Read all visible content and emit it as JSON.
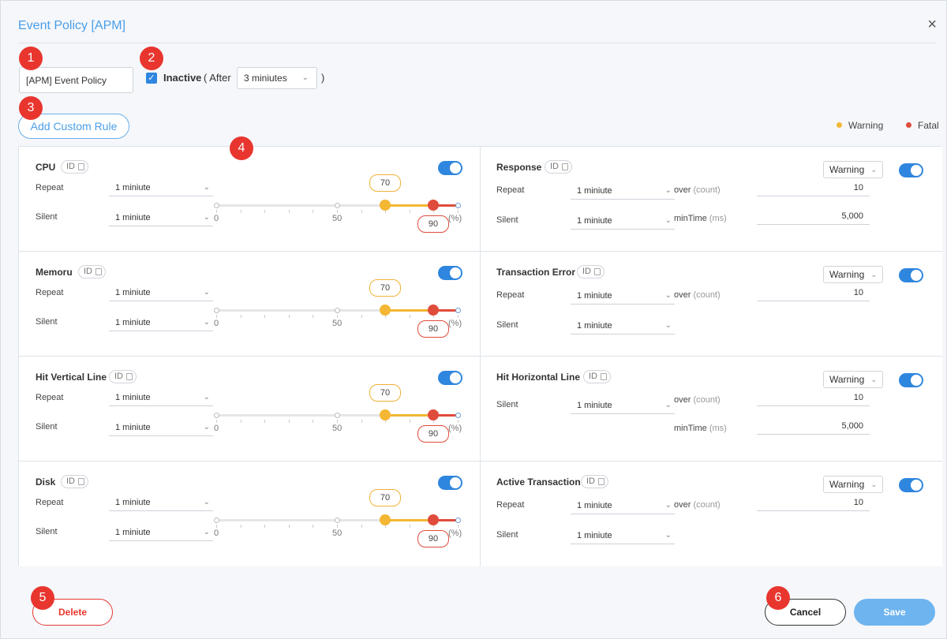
{
  "modal": {
    "title": "Event Policy [APM]",
    "close_glyph": "×"
  },
  "markers": [
    "1",
    "2",
    "3",
    "4",
    "5",
    "6"
  ],
  "policy": {
    "name_value": "[APM] Event Policy",
    "inactive_checked": true,
    "inactive_label": "Inactive",
    "after_prefix": "( After",
    "after_value": "3 miniutes",
    "after_suffix": ")"
  },
  "add_rule_label": "Add Custom Rule",
  "legend": [
    {
      "label": "Warning",
      "color": "#f3b733"
    },
    {
      "label": "Fatal",
      "color": "#e04c3c"
    }
  ],
  "common": {
    "repeat_label": "Repeat",
    "silent_label": "Silent",
    "select_value": "1 miniute",
    "id_label": "ID",
    "slider_tick_0": "0",
    "slider_tick_50": "50",
    "slider_unit": "(%)",
    "over_label": "over",
    "count_unit": "(count)",
    "mintime_label": "minTime",
    "ms_unit": "(ms)",
    "severity_value": "Warning"
  },
  "left_rules": [
    {
      "title": "CPU",
      "enabled": true,
      "warning": 70,
      "fatal": 90
    },
    {
      "title": "Memoru",
      "enabled": true,
      "warning": 70,
      "fatal": 90
    },
    {
      "title": "Hit Vertical Line",
      "enabled": true,
      "warning": 70,
      "fatal": 90
    },
    {
      "title": "Disk",
      "enabled": true,
      "warning": 70,
      "fatal": 90
    }
  ],
  "right_rules": [
    {
      "title": "Response",
      "enabled": true,
      "over_value": "10",
      "mintime_value": "5,000"
    },
    {
      "title": "Transaction Error",
      "enabled": true,
      "over_value": "10"
    },
    {
      "title": "Hit Horizontal Line",
      "enabled": true,
      "over_value": "10",
      "mintime_value": "5,000"
    },
    {
      "title": "Active Transaction",
      "enabled": true,
      "over_value": "10"
    }
  ],
  "footer": {
    "delete_label": "Delete",
    "cancel_label": "Cancel",
    "save_label": "Save"
  }
}
